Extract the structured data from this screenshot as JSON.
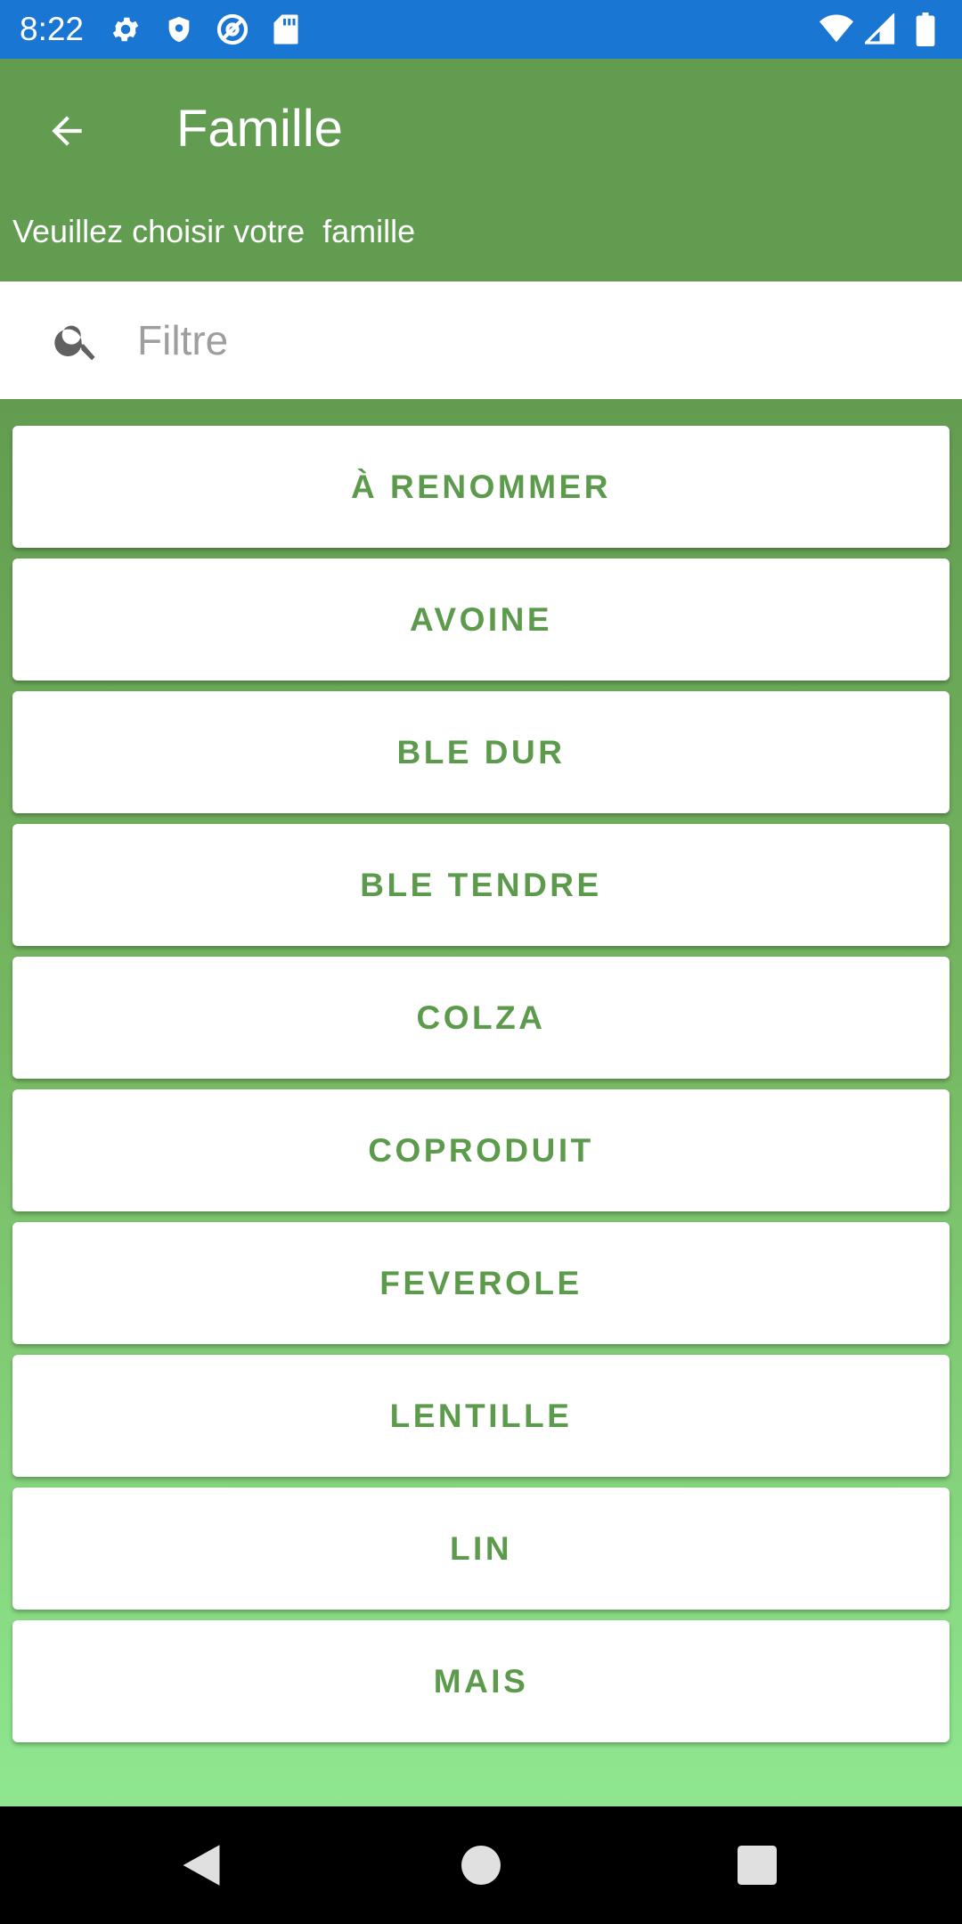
{
  "status_bar": {
    "time": "8:22",
    "left_icons": [
      "settings-icon",
      "shield-icon",
      "at-sign-icon",
      "sd-card-icon"
    ],
    "right_icons": [
      "wifi-icon",
      "cell-signal-icon",
      "battery-icon"
    ]
  },
  "app_bar": {
    "title": "Famille",
    "subtitle": "Veuillez choisir votre  famille",
    "back_icon": "back-arrow-icon",
    "color": "#629c50"
  },
  "search": {
    "placeholder": "Filtre",
    "value": ""
  },
  "families": [
    "À RENOMMER",
    "AVOINE",
    "BLE DUR",
    "BLE TENDRE",
    "COLZA",
    "COPRODUIT",
    "FEVEROLE",
    "LENTILLE",
    "LIN",
    "MAIS"
  ],
  "colors": {
    "status_bar": "#1976d2",
    "accent_text": "#5c9a4c",
    "list_gradient_end": "#8fe78f"
  },
  "nav_bar": {
    "buttons": [
      "back-triangle-icon",
      "home-circle-icon",
      "recents-square-icon"
    ]
  }
}
